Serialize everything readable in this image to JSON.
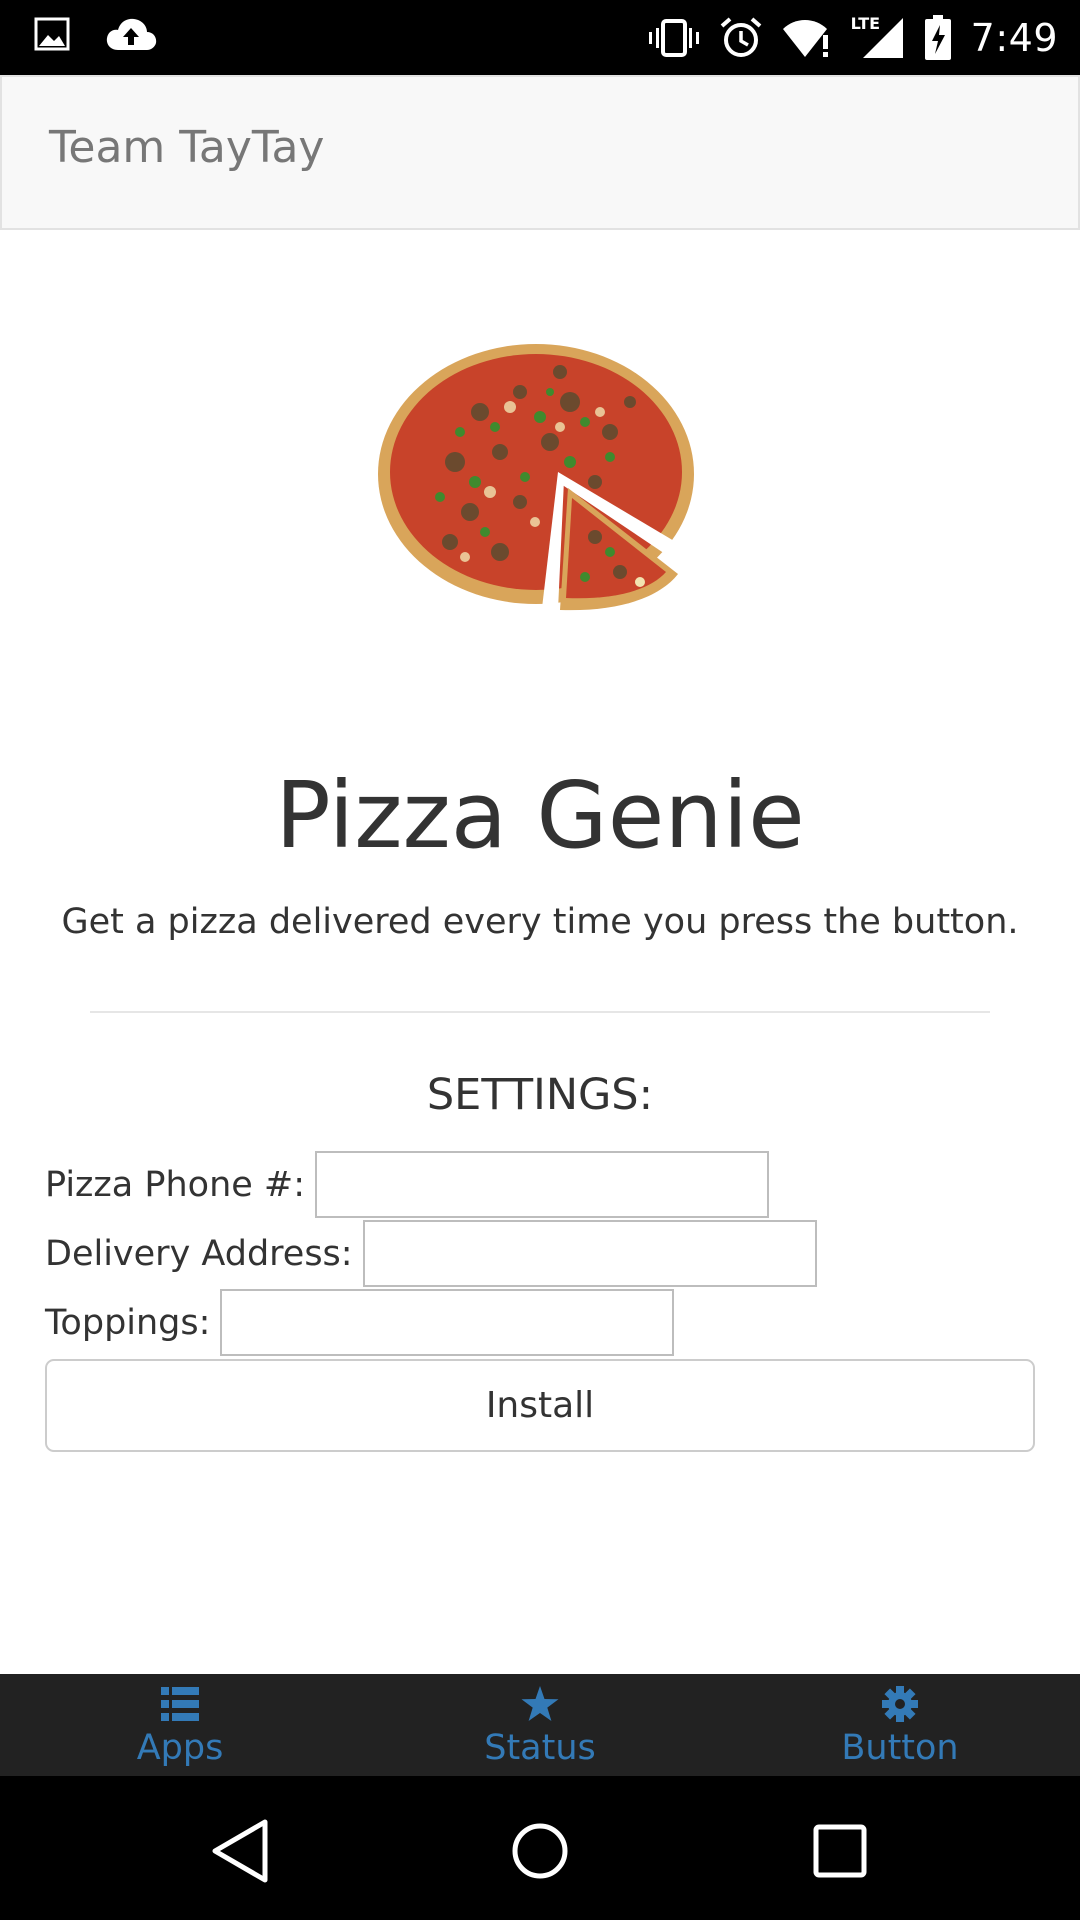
{
  "status_bar": {
    "time": "7:49",
    "network_label": "LTE",
    "icons": [
      "gallery-icon",
      "cloud-upload-icon",
      "vibrate-icon",
      "alarm-icon",
      "wifi-alert-icon",
      "lte-signal-icon",
      "battery-charging-icon"
    ]
  },
  "header": {
    "brand": "Team TayTay"
  },
  "main": {
    "image_alt": "pizza-image",
    "title": "Pizza Genie",
    "tagline": "Get a pizza delivered every time you press the button.",
    "settings_heading": "SETTINGS:",
    "fields": [
      {
        "label": "Pizza Phone #:",
        "value": "",
        "placeholder": ""
      },
      {
        "label": "Delivery Address:",
        "value": "",
        "placeholder": ""
      },
      {
        "label": "Toppings:",
        "value": "",
        "placeholder": ""
      }
    ],
    "install_label": "Install"
  },
  "tabbar": {
    "tabs": [
      {
        "label": "Apps",
        "icon": "list-icon"
      },
      {
        "label": "Status",
        "icon": "star-icon"
      },
      {
        "label": "Button",
        "icon": "gear-icon"
      }
    ]
  },
  "navbar": {
    "buttons": [
      "back-icon",
      "home-icon",
      "recents-icon"
    ]
  },
  "colors": {
    "accent": "#337ab7",
    "tabbar_bg": "#222222",
    "header_bg": "#f8f8f8",
    "text": "#333333",
    "brand_text": "#777777"
  }
}
